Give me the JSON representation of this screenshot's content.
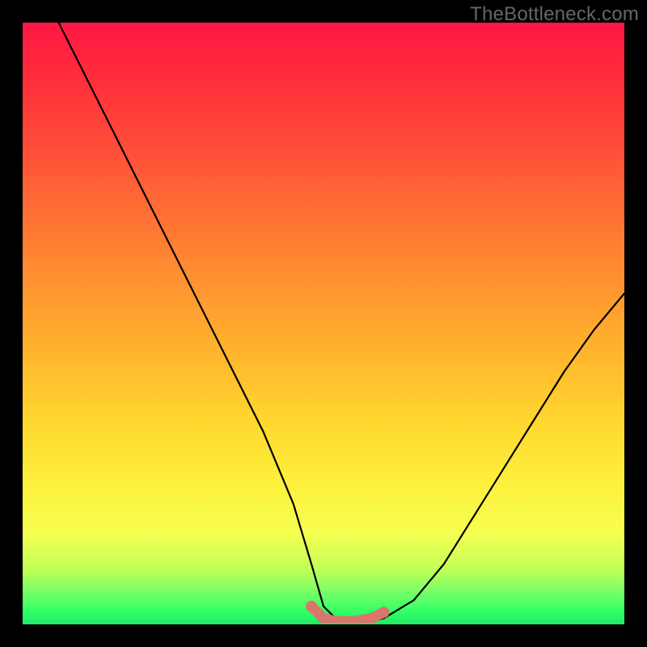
{
  "watermark": "TheBottleneck.com",
  "colors": {
    "frame": "#000000",
    "gradient_top": "#ff1744",
    "gradient_mid1": "#ff8f30",
    "gradient_mid2": "#ffd62e",
    "gradient_bottom": "#21e867",
    "curve": "#000000",
    "highlight": "#d9756a"
  },
  "chart_data": {
    "type": "line",
    "title": "",
    "xlabel": "",
    "ylabel": "",
    "x_range": [
      0,
      100
    ],
    "y_range": [
      0,
      100
    ],
    "grid": false,
    "legend": false,
    "series": [
      {
        "name": "bottleneck-curve",
        "x": [
          6,
          10,
          15,
          20,
          25,
          30,
          35,
          40,
          45,
          48,
          50,
          52,
          55,
          58,
          60,
          65,
          70,
          75,
          80,
          85,
          90,
          95,
          100
        ],
        "y": [
          100,
          92,
          82,
          72,
          62,
          52,
          42,
          32,
          20,
          10,
          3,
          1,
          0.5,
          0.5,
          1,
          4,
          10,
          18,
          26,
          34,
          42,
          49,
          55
        ]
      }
    ],
    "annotations": [
      {
        "name": "bottom-highlight-band",
        "kind": "segmented-stroke",
        "x": [
          48,
          50,
          52,
          55,
          58,
          60
        ],
        "y": [
          3,
          1,
          0.5,
          0.5,
          1,
          2
        ],
        "color": "#d9756a"
      }
    ]
  }
}
